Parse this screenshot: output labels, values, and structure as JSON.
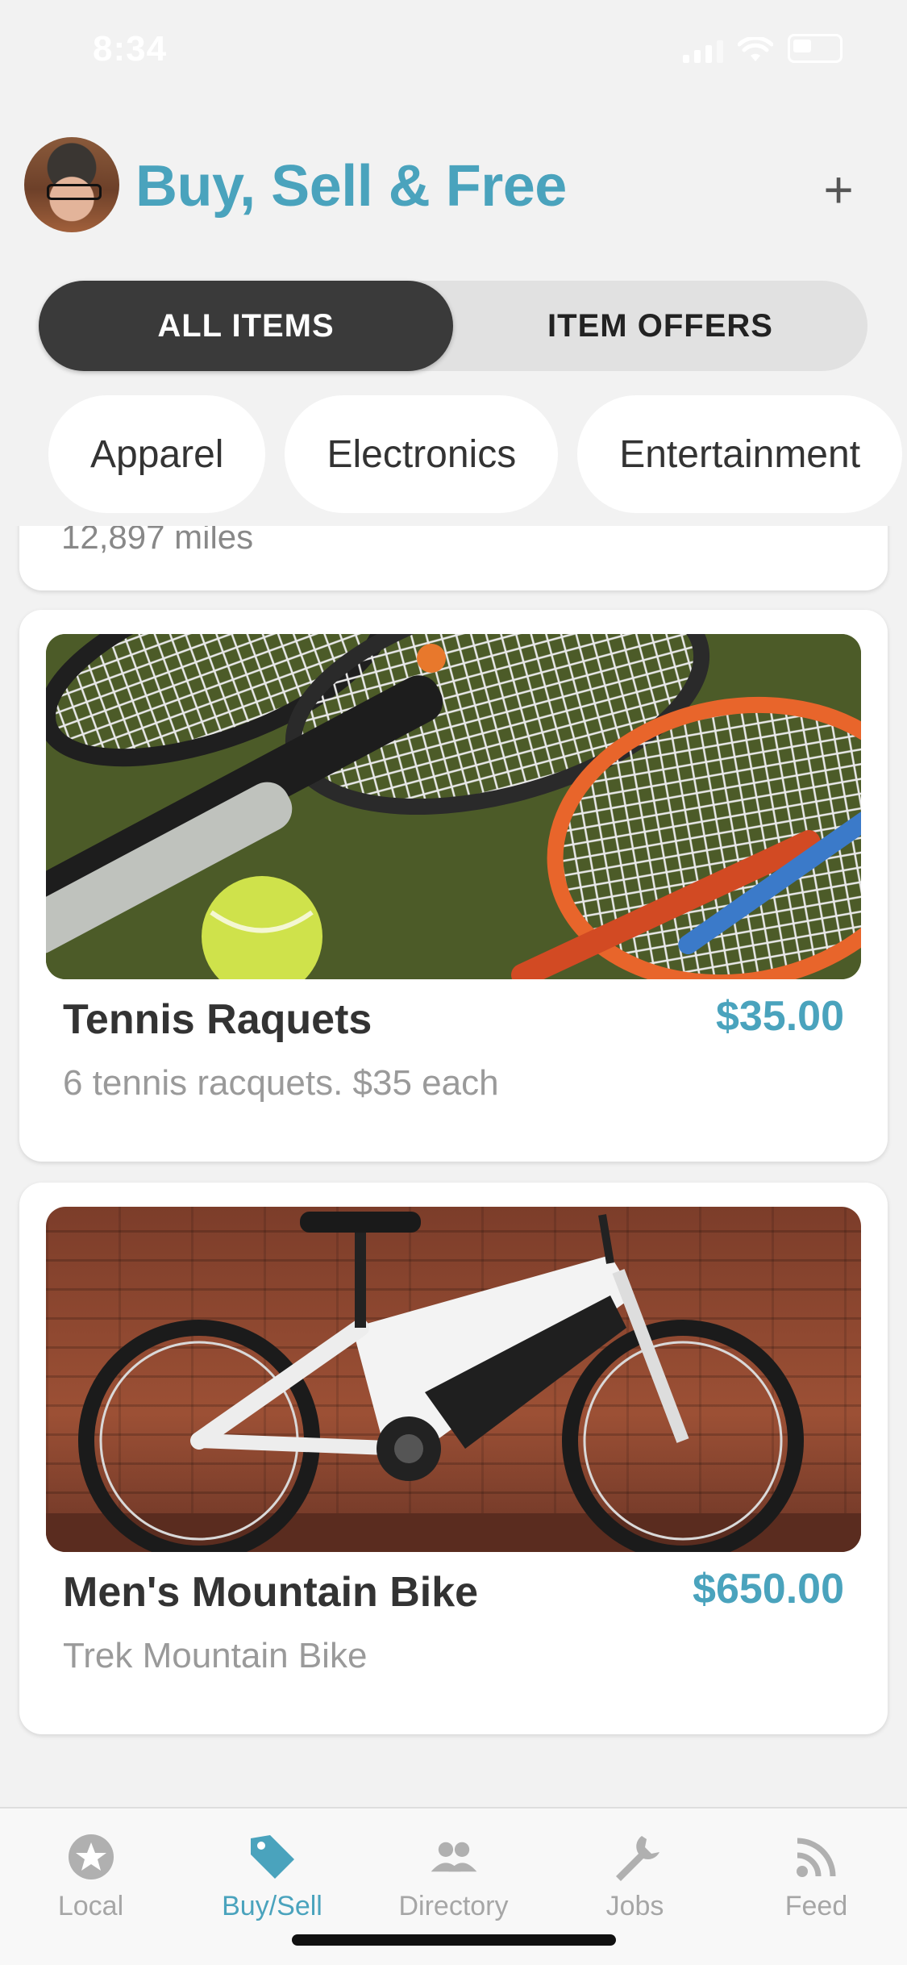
{
  "status_bar": {
    "time": "8:34"
  },
  "header": {
    "title": "Buy, Sell & Free",
    "add_label": "+"
  },
  "segmented": {
    "items": [
      {
        "label": "ALL ITEMS",
        "active": true
      },
      {
        "label": "ITEM OFFERS",
        "active": false
      }
    ]
  },
  "categories": [
    "Apparel",
    "Electronics",
    "Entertainment"
  ],
  "listings": {
    "partial_text": "12,897 miles",
    "items": [
      {
        "title": "Tennis Raquets",
        "price": "$35.00",
        "description": "6 tennis racquets. $35 each",
        "photo": "tennis-racquets-photo"
      },
      {
        "title": "Men's Mountain Bike",
        "price": "$650.00",
        "description": "Trek Mountain Bike",
        "photo": "mountain-bike-photo"
      }
    ]
  },
  "tab_bar": {
    "tabs": [
      {
        "label": "Local",
        "icon": "star-icon",
        "active": false
      },
      {
        "label": "Buy/Sell",
        "icon": "tag-icon",
        "active": true
      },
      {
        "label": "Directory",
        "icon": "people-icon",
        "active": false
      },
      {
        "label": "Jobs",
        "icon": "wrench-icon",
        "active": false
      },
      {
        "label": "Feed",
        "icon": "rss-icon",
        "active": false
      }
    ]
  },
  "colors": {
    "accent": "#4aa3bd",
    "segment_active_bg": "#3a3a3a",
    "inactive_tab": "#a6a6a6"
  }
}
